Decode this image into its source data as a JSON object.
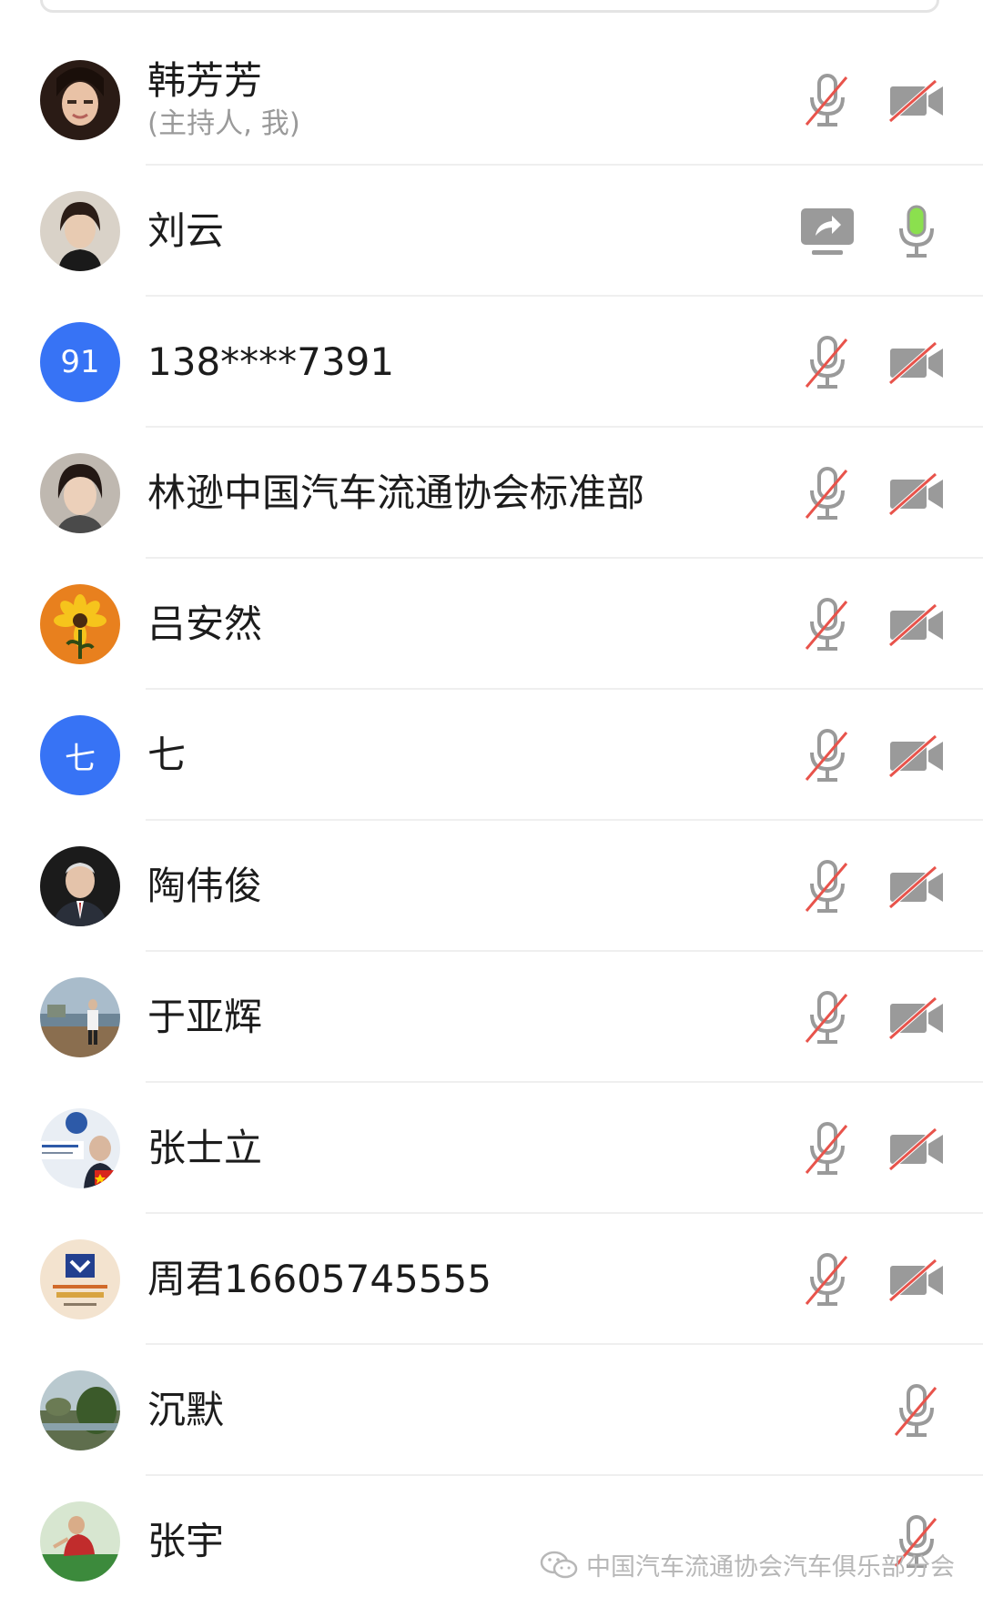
{
  "participants": [
    {
      "name": "韩芳芳",
      "subtitle": "(主持人, 我)"
    },
    {
      "name": "刘云"
    },
    {
      "name": "138****7391",
      "avatar_text": "91"
    },
    {
      "name": "林逊中国汽车流通协会标准部"
    },
    {
      "name": "吕安然"
    },
    {
      "name": "七",
      "avatar_text": "七"
    },
    {
      "name": "陶伟俊"
    },
    {
      "name": "于亚辉"
    },
    {
      "name": "张士立"
    },
    {
      "name": "周君16605745555"
    },
    {
      "name": "沉默"
    },
    {
      "name": "张宇"
    }
  ],
  "watermark": {
    "text": "中国汽车流通协会汽车俱乐部分会"
  },
  "colors": {
    "accent_blue": "#3773f5",
    "mute_red": "#e8534b",
    "mic_on_green": "#8be04e",
    "icon_gray": "#9a9a9a"
  }
}
